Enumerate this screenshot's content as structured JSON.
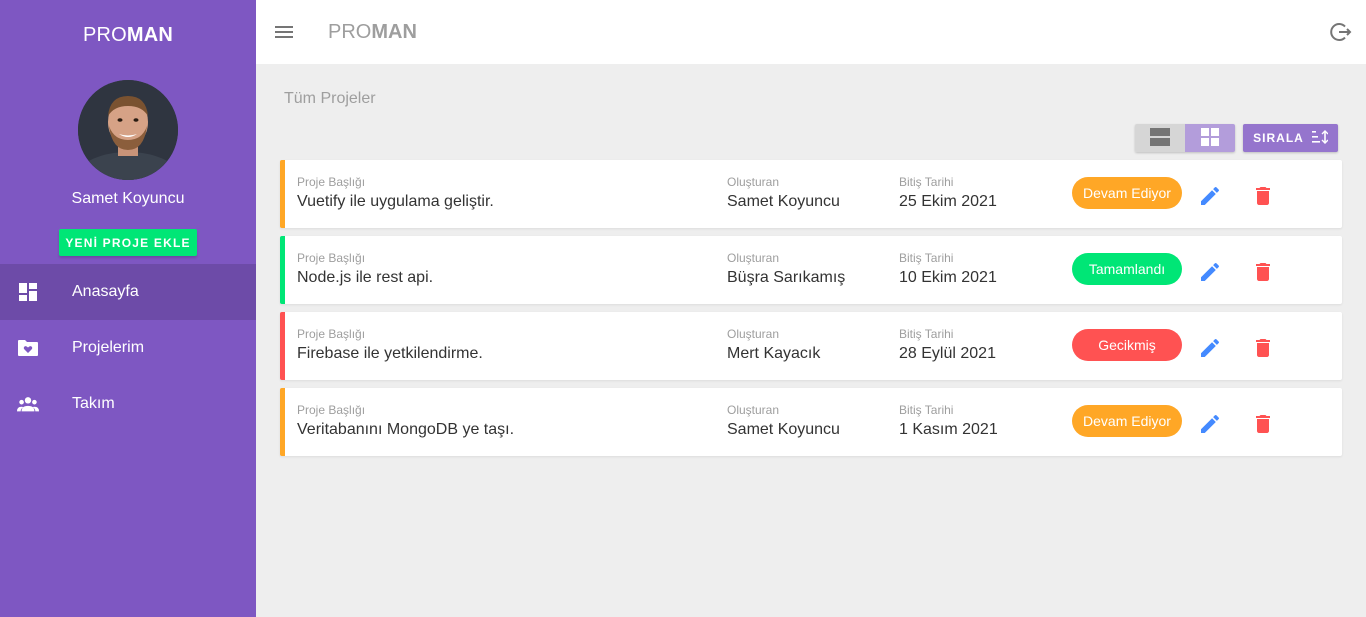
{
  "brand": {
    "part1": "PRO",
    "part2": "MAN"
  },
  "user": {
    "name": "Samet Koyuncu"
  },
  "sidebar": {
    "new_project_label": "YENİ PROJE EKLE",
    "items": [
      {
        "label": "Anasayfa",
        "icon": "dashboard-icon",
        "active": true
      },
      {
        "label": "Projelerim",
        "icon": "folder-heart-icon",
        "active": false
      },
      {
        "label": "Takım",
        "icon": "team-icon",
        "active": false
      }
    ]
  },
  "topbar": {
    "title_part1": "PRO",
    "title_part2": "MAN"
  },
  "main": {
    "page_title": "Tüm Projeler",
    "sort_label": "SIRALA"
  },
  "projects": [
    {
      "title_caption": "Proje Başlığı",
      "title": "Vuetify ile uygulama geliştir.",
      "person_caption": "Oluşturan",
      "person": "Samet Koyuncu",
      "date_caption": "Bitiş Tarihi",
      "date": "25 Ekim 2021",
      "status": "Devam Ediyor",
      "status_type": "ongoing"
    },
    {
      "title_caption": "Proje Başlığı",
      "title": "Node.js ile rest api.",
      "person_caption": "Oluşturan",
      "person": "Büşra Sarıkamış",
      "date_caption": "Bitiş Tarihi",
      "date": "10 Ekim 2021",
      "status": "Tamamlandı",
      "status_type": "complete"
    },
    {
      "title_caption": "Proje Başlığı",
      "title": "Firebase ile yetkilendirme.",
      "person_caption": "Oluşturan",
      "person": "Mert Kayacık",
      "date_caption": "Bitiş Tarihi",
      "date": "28 Eylül 2021",
      "status": "Gecikmiş",
      "status_type": "overdue"
    },
    {
      "title_caption": "Proje Başlığı",
      "title": "Veritabanını MongoDB ye taşı.",
      "person_caption": "Oluşturan",
      "person": "Samet Koyuncu",
      "date_caption": "Bitiş Tarihi",
      "date": "1 Kasım 2021",
      "status": "Devam Ediyor",
      "status_type": "ongoing"
    }
  ],
  "colors": {
    "sidebar": "#7e57c2",
    "ongoing": "#ffa726",
    "complete": "#00e676",
    "overdue": "#ff5252",
    "edit": "#448aff",
    "delete": "#ff5252"
  }
}
